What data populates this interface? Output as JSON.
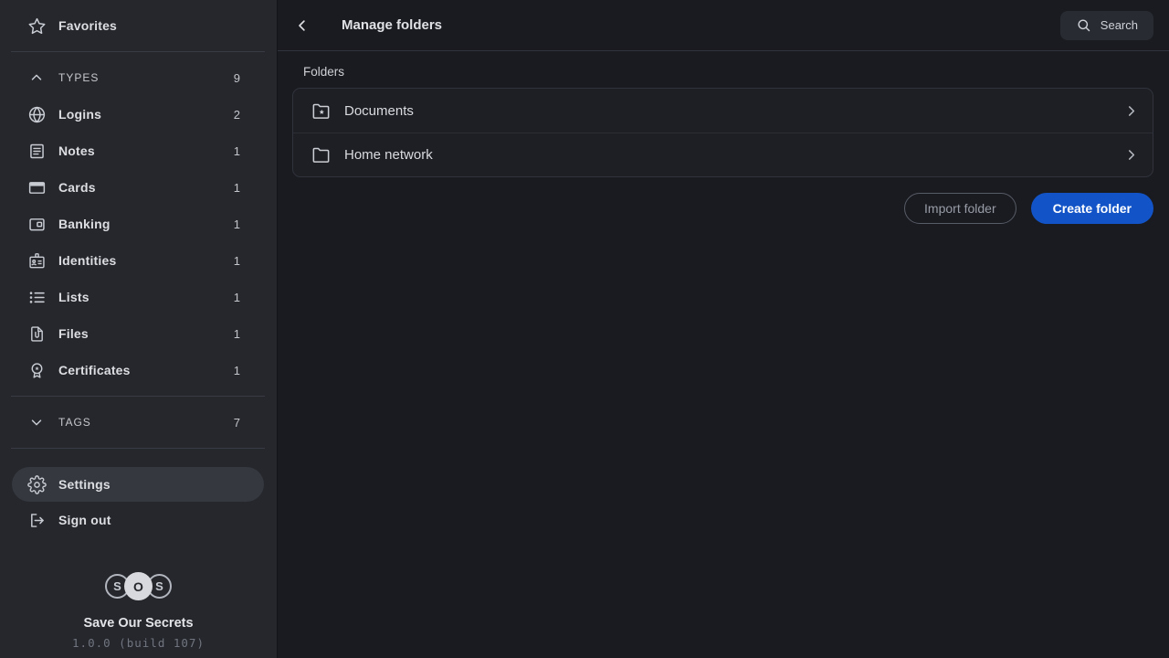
{
  "sidebar": {
    "favorites": {
      "label": "Favorites"
    },
    "types_section": {
      "label": "TYPES",
      "count": "9",
      "state": "expanded"
    },
    "types_items": [
      {
        "label": "Logins",
        "count": "2",
        "icon": "globe-icon"
      },
      {
        "label": "Notes",
        "count": "1",
        "icon": "note-icon"
      },
      {
        "label": "Cards",
        "count": "1",
        "icon": "credit-card-icon"
      },
      {
        "label": "Banking",
        "count": "1",
        "icon": "wallet-icon"
      },
      {
        "label": "Identities",
        "count": "1",
        "icon": "id-badge-icon"
      },
      {
        "label": "Lists",
        "count": "1",
        "icon": "list-icon"
      },
      {
        "label": "Files",
        "count": "1",
        "icon": "file-paperclip-icon"
      },
      {
        "label": "Certificates",
        "count": "1",
        "icon": "certificate-icon"
      }
    ],
    "tags_section": {
      "label": "TAGS",
      "count": "7",
      "state": "collapsed"
    },
    "settings_label": "Settings",
    "signout_label": "Sign out",
    "footer": {
      "logo_letters": {
        "left": "S",
        "middle": "O",
        "right": "S"
      },
      "app_name": "Save Our Secrets",
      "version": "1.0.0 (build 107)"
    }
  },
  "header": {
    "title": "Manage folders",
    "search_label": "Search"
  },
  "main": {
    "folders_label": "Folders",
    "folders": [
      {
        "name": "Documents",
        "icon": "folder-star-icon"
      },
      {
        "name": "Home network",
        "icon": "folder-icon"
      }
    ],
    "actions": {
      "import_label": "Import folder",
      "create_label": "Create folder"
    }
  },
  "colors": {
    "accent_blue": "#1254c8",
    "sidebar_bg": "#25272d",
    "main_bg": "#1a1b21",
    "selected_item_bg": "#35383f"
  }
}
